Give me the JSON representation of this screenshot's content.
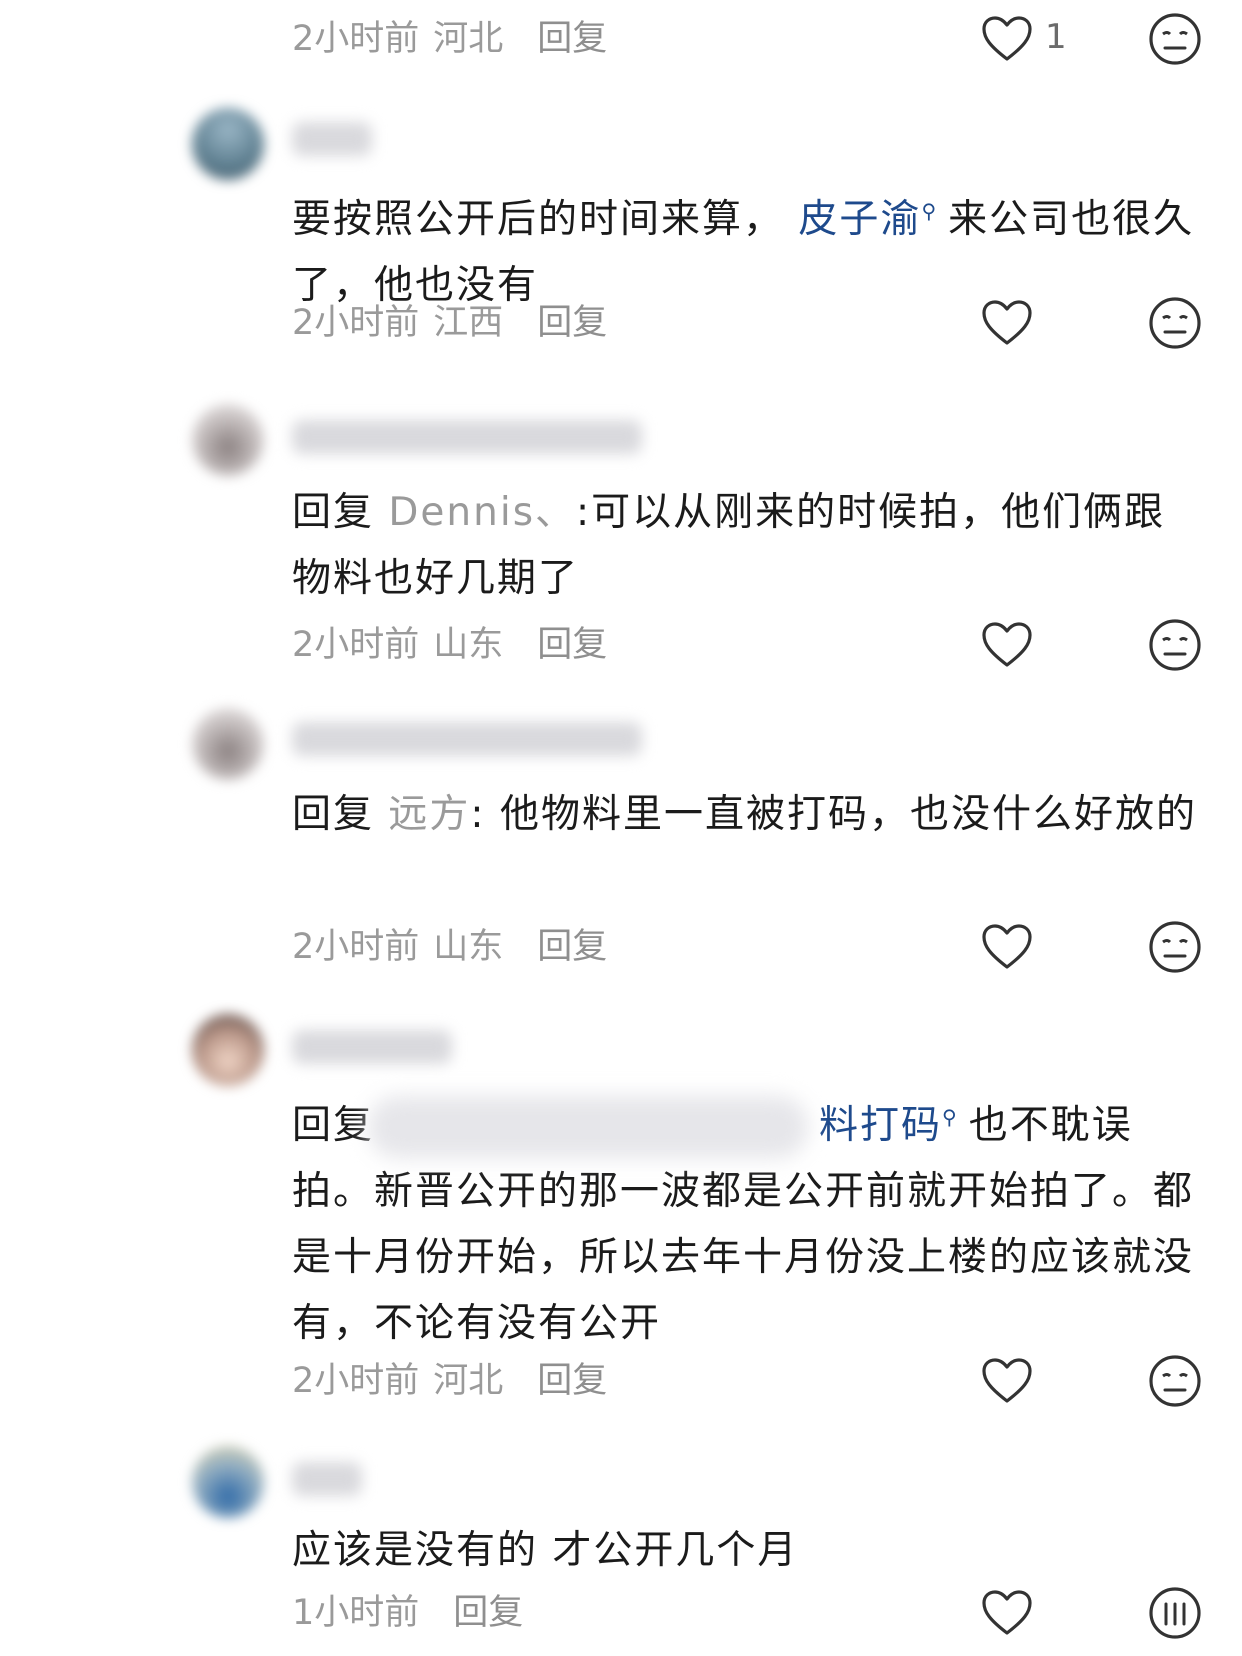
{
  "comments": [
    {
      "time": "2小时前",
      "location": "河北",
      "reply_label": "回复",
      "likes": "1"
    },
    {
      "text_part1": "要按照公开后的时间来算，",
      "mention": "皮子渝",
      "text_part2": "来公司也很久了，他也没有",
      "time": "2小时前",
      "location": "江西",
      "reply_label": "回复"
    },
    {
      "reply_prefix": "回复 ",
      "reply_target": "Dennis、",
      "text": ":可以从刚来的时候拍，他们俩跟物料也好几期了",
      "time": "2小时前",
      "location": "山东",
      "reply_label": "回复"
    },
    {
      "reply_prefix": "回复 ",
      "reply_target": "远方",
      "text": ": 他物料里一直被打码，也没什么好放的",
      "time": "2小时前",
      "location": "山东",
      "reply_label": "回复"
    },
    {
      "reply_prefix": "回复",
      "mention": "料打码",
      "text_part1": "也不耽误",
      "text_part2": "拍。新晋公开的那一波都是公开前就开始拍了。都是十月份开始，所以去年十月份没上楼的应该就没有，不论有没有公开",
      "time": "2小时前",
      "location": "河北",
      "reply_label": "回复"
    },
    {
      "text": "应该是没有的 才公开几个月",
      "time": "1小时前",
      "location": "",
      "reply_label": "回复"
    }
  ],
  "icons": {
    "like": "heart-outline-icon",
    "reaction": "neutral-face-icon"
  },
  "colors": {
    "mention": "#1e4a8c",
    "meta": "#9a9a9a",
    "text": "#1b1b1b"
  }
}
